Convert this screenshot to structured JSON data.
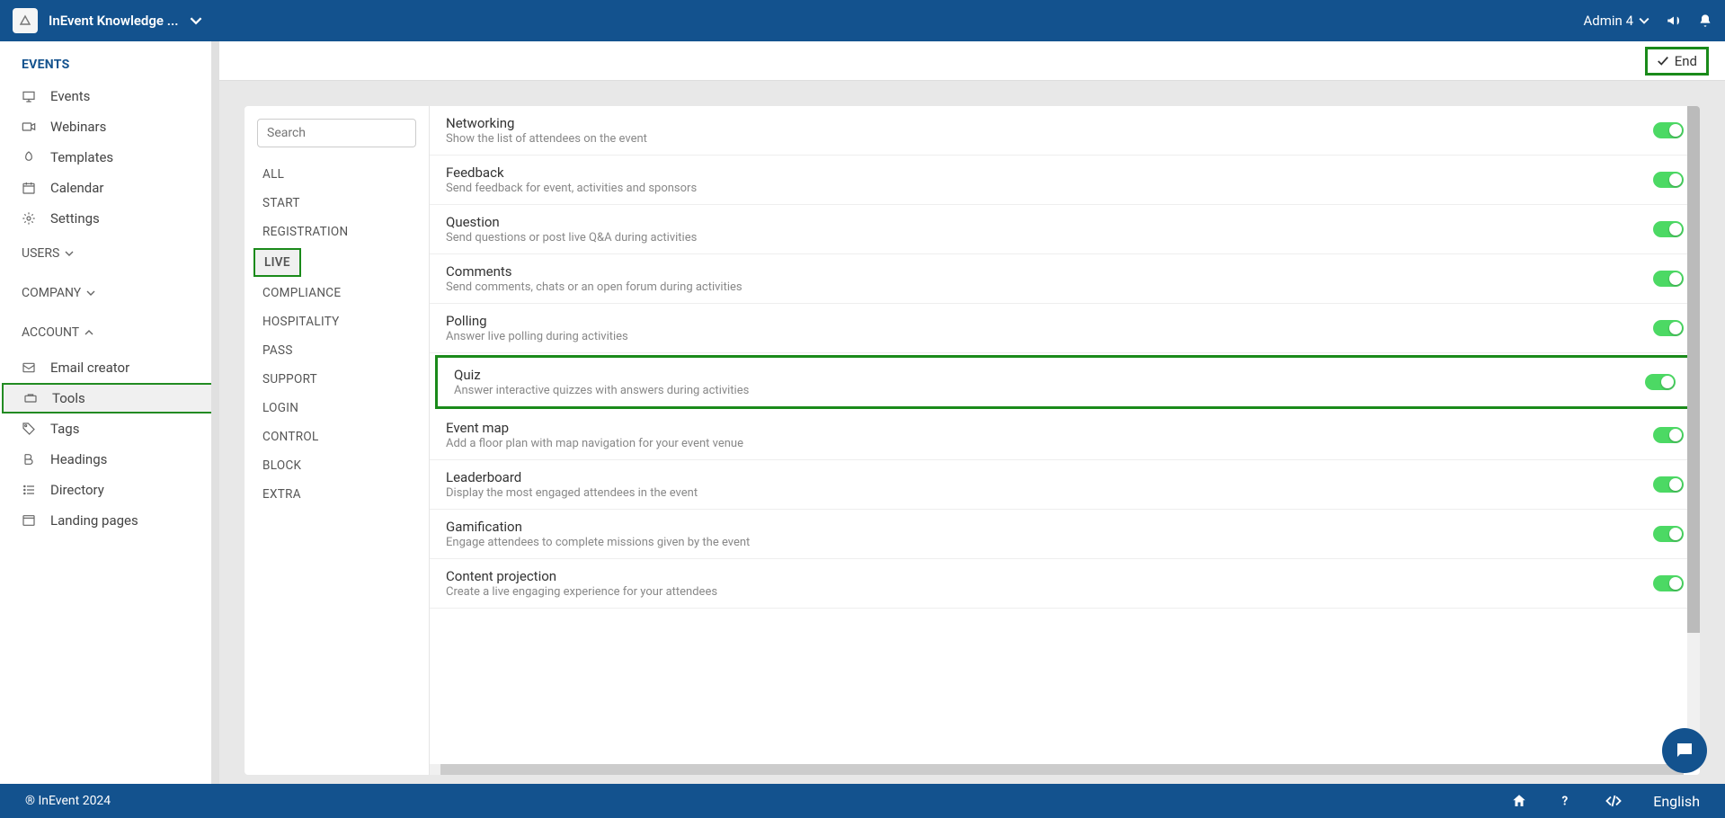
{
  "topbar": {
    "title": "InEvent Knowledge ...",
    "user": "Admin 4"
  },
  "sidebar": {
    "section_events": "EVENTS",
    "items": [
      {
        "label": "Events"
      },
      {
        "label": "Webinars"
      },
      {
        "label": "Templates"
      },
      {
        "label": "Calendar"
      },
      {
        "label": "Settings"
      }
    ],
    "section_users": "USERS",
    "section_company": "COMPANY",
    "section_account": "ACCOUNT",
    "account_items": [
      {
        "label": "Email creator"
      },
      {
        "label": "Tools"
      },
      {
        "label": "Tags"
      },
      {
        "label": "Headings"
      },
      {
        "label": "Directory"
      },
      {
        "label": "Landing pages"
      }
    ]
  },
  "header": {
    "end_label": "End"
  },
  "search": {
    "placeholder": "Search"
  },
  "categories": [
    "ALL",
    "START",
    "REGISTRATION",
    "LIVE",
    "COMPLIANCE",
    "HOSPITALITY",
    "PASS",
    "SUPPORT",
    "LOGIN",
    "CONTROL",
    "BLOCK",
    "EXTRA"
  ],
  "active_category": "LIVE",
  "settings": [
    {
      "title": "Networking",
      "desc": "Show the list of attendees on the event"
    },
    {
      "title": "Feedback",
      "desc": "Send feedback for event, activities and sponsors"
    },
    {
      "title": "Question",
      "desc": "Send questions or post live Q&A during activities"
    },
    {
      "title": "Comments",
      "desc": "Send comments, chats or an open forum during activities"
    },
    {
      "title": "Polling",
      "desc": "Answer live polling during activities"
    },
    {
      "title": "Quiz",
      "desc": "Answer interactive quizzes with answers during activities"
    },
    {
      "title": "Event map",
      "desc": "Add a floor plan with map navigation for your event venue"
    },
    {
      "title": "Leaderboard",
      "desc": "Display the most engaged attendees in the event"
    },
    {
      "title": "Gamification",
      "desc": "Engage attendees to complete missions given by the event"
    },
    {
      "title": "Content projection",
      "desc": "Create a live engaging experience for your attendees"
    }
  ],
  "highlighted_setting": "Quiz",
  "active_sidebar_item": "Tools",
  "footer": {
    "copyright": "® InEvent 2024",
    "lang": "English"
  }
}
